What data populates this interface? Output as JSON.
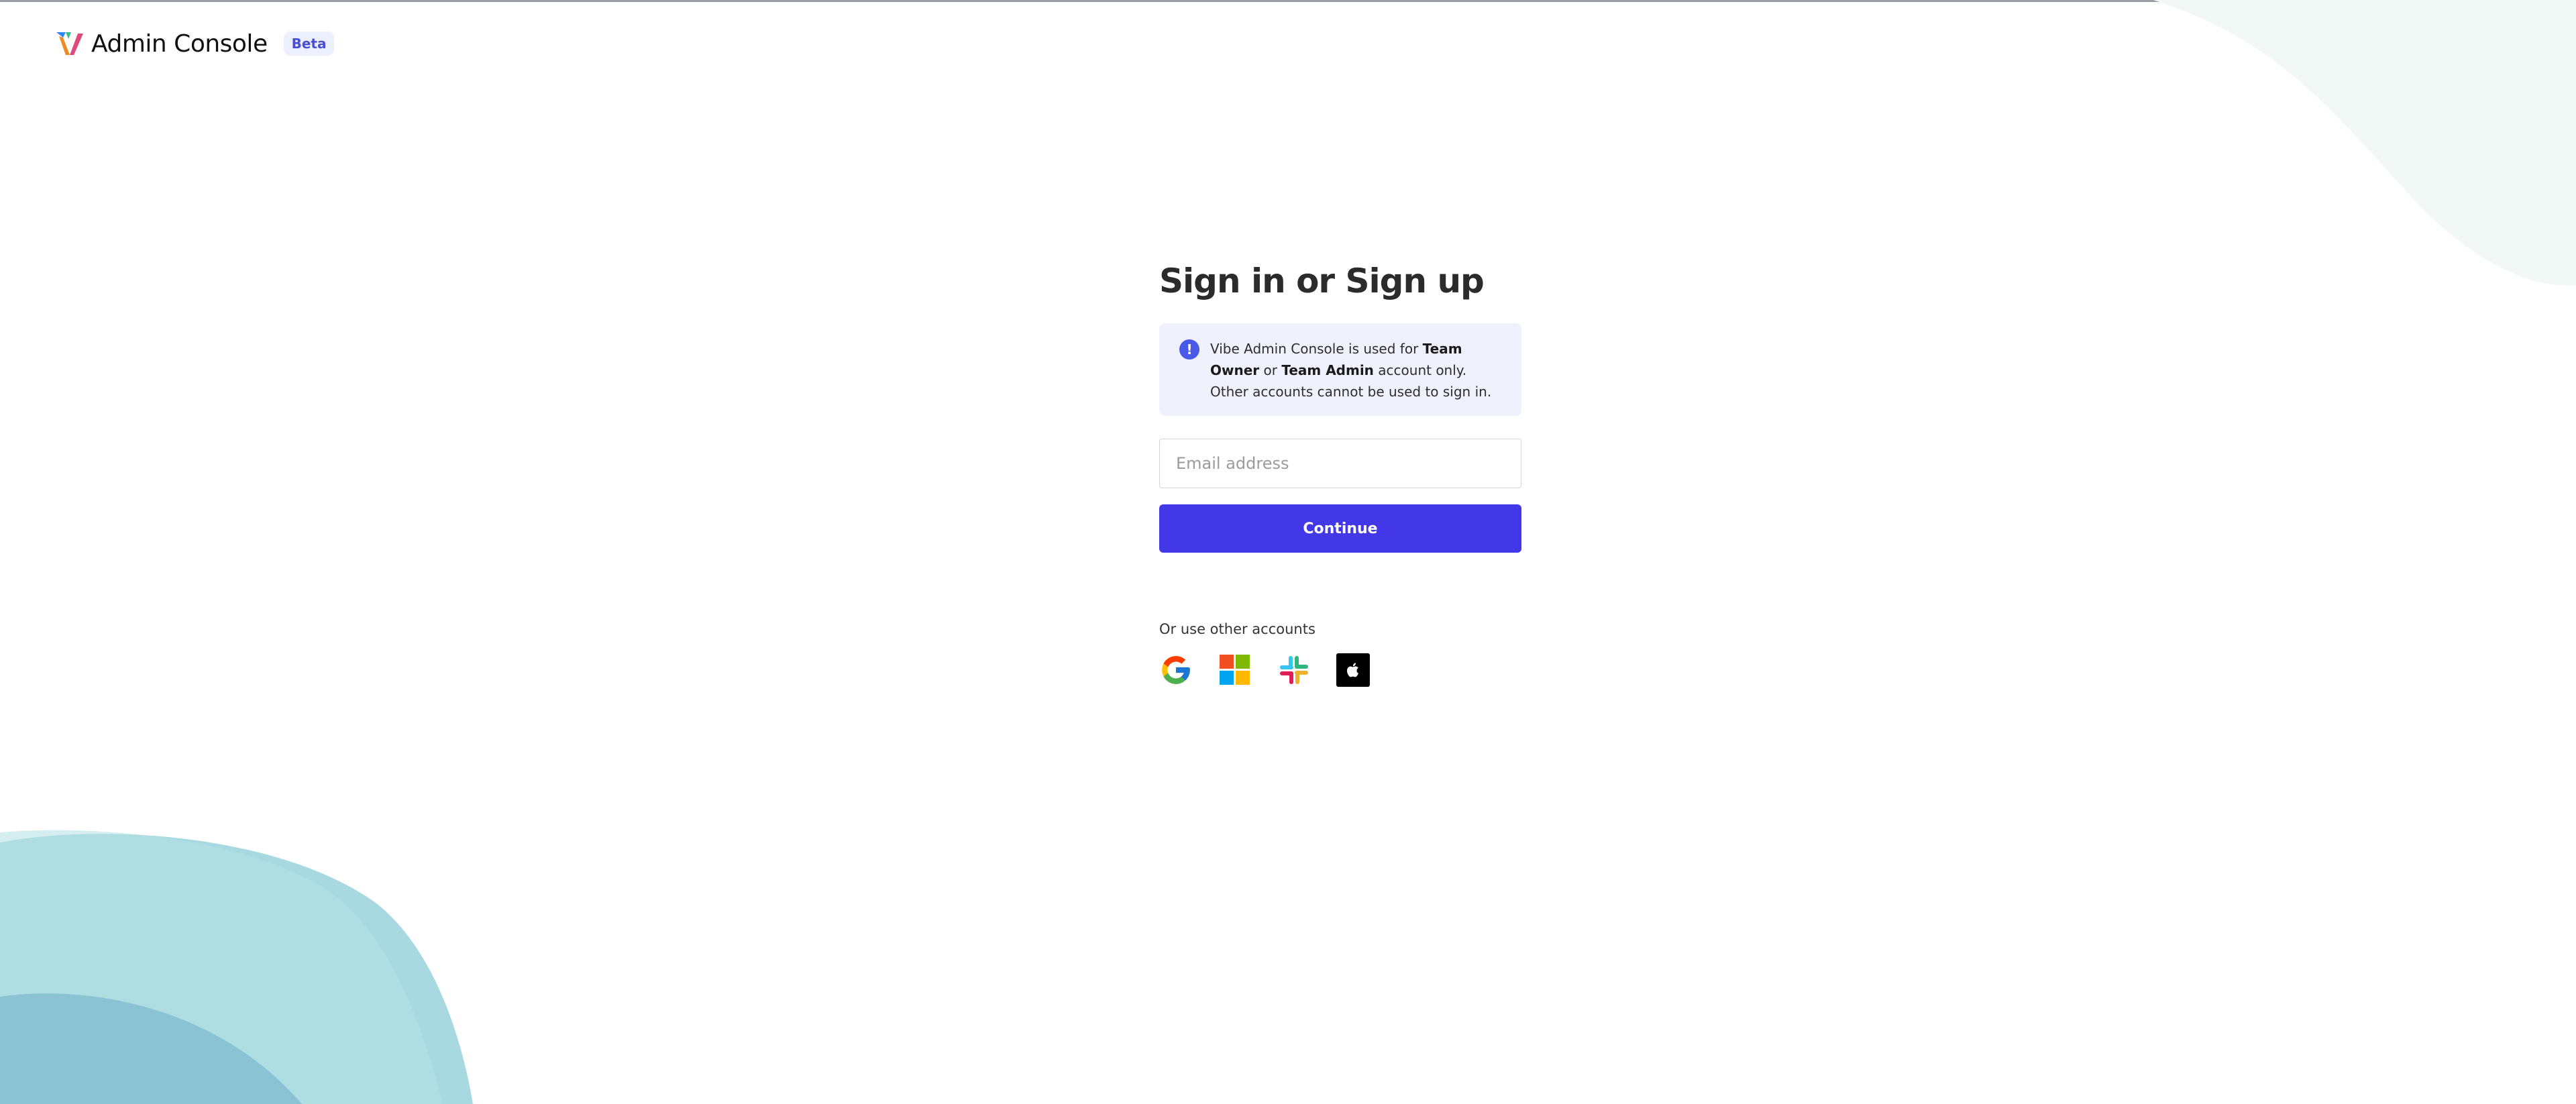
{
  "header": {
    "app_title": "Admin Console",
    "badge": "Beta"
  },
  "signin": {
    "title": "Sign in or Sign up",
    "notice": {
      "icon": "info-icon",
      "icon_glyph": "!",
      "text_prefix": "Vibe Admin Console is used for ",
      "role_owner": "Team Owner",
      "text_or": " or ",
      "role_admin": "Team Admin",
      "text_suffix": " account only. Other accounts cannot be used to sign in."
    },
    "email": {
      "placeholder": "Email address",
      "value": ""
    },
    "continue_label": "Continue",
    "other_accounts_label": "Or use other accounts",
    "providers": [
      {
        "name": "Google",
        "icon": "google-icon"
      },
      {
        "name": "Microsoft",
        "icon": "microsoft-icon"
      },
      {
        "name": "Slack",
        "icon": "slack-icon"
      },
      {
        "name": "Apple",
        "icon": "apple-icon"
      }
    ]
  },
  "colors": {
    "primary": "#4338e8",
    "notice_bg": "#eff2fd",
    "badge_bg": "#eceffd",
    "badge_text": "#4a4fd1"
  }
}
